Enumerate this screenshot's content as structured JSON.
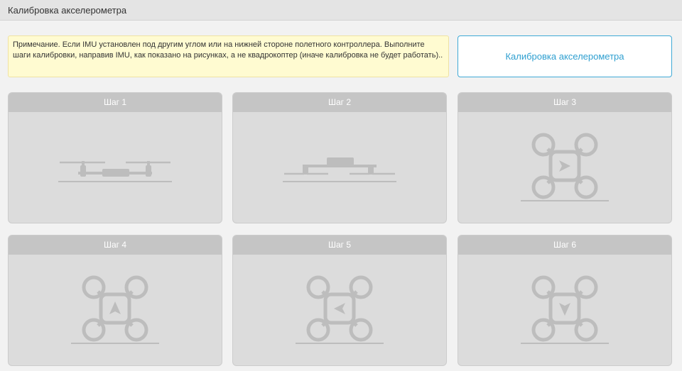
{
  "header": {
    "title": "Калибровка акселерометра"
  },
  "note": {
    "text": "Примечание. Если IMU установлен под другим углом или на нижней стороне полетного контроллера. Выполните шаги калибровки, направив IMU, как показано на рисунках, а не квадрокоптер (иначе калибровка не будет работать).."
  },
  "calibrate_button": {
    "label": "Калибровка акселерометра"
  },
  "colors": {
    "accent": "#2e9fd0",
    "note_bg": "#fffbd1",
    "drawing": "#bdbdbd"
  },
  "steps": [
    {
      "label": "Шаг 1",
      "icon": "quadcopter-side-level-icon"
    },
    {
      "label": "Шаг 2",
      "icon": "quadcopter-side-inverted-icon"
    },
    {
      "label": "Шаг 3",
      "icon": "quadcopter-top-arrow-right-icon"
    },
    {
      "label": "Шаг 4",
      "icon": "quadcopter-top-arrow-up-icon"
    },
    {
      "label": "Шаг 5",
      "icon": "quadcopter-top-arrow-left-icon"
    },
    {
      "label": "Шаг 6",
      "icon": "quadcopter-top-arrow-down-icon"
    }
  ]
}
